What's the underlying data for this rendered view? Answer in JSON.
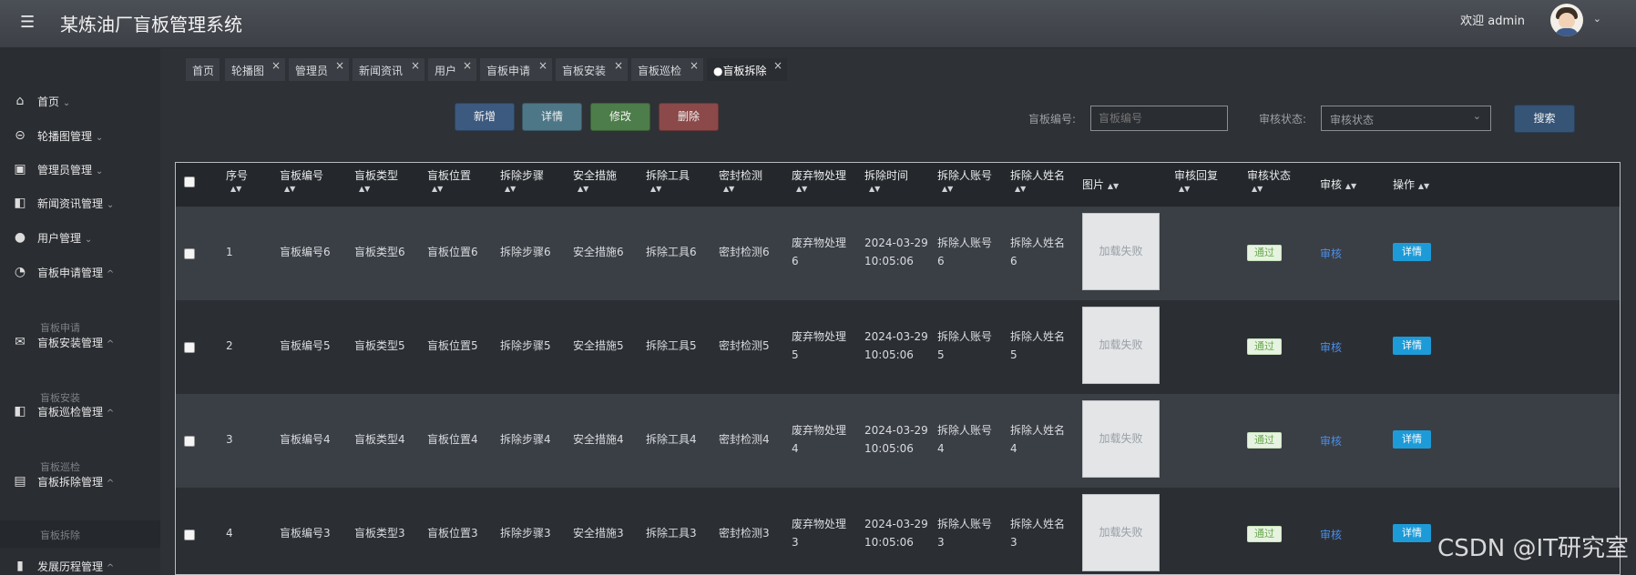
{
  "header": {
    "menu_icon": "hamburger-icon",
    "title": "某炼油厂盲板管理系统",
    "welcome": "欢迎 admin",
    "avatar_caret": "⌄"
  },
  "sidebar": {
    "items": [
      {
        "label": "首页",
        "icon": "home-icon",
        "caret": "⌄"
      },
      {
        "label": "轮播图管理",
        "icon": "dots-icon",
        "caret": "⌄"
      },
      {
        "label": "管理员管理",
        "icon": "user-square-icon",
        "caret": "⌄"
      },
      {
        "label": "新闻资讯管理",
        "icon": "book-icon",
        "caret": "⌄"
      },
      {
        "label": "用户管理",
        "icon": "person-icon",
        "caret": "⌄"
      },
      {
        "label": "盲板申请管理",
        "icon": "gauge-icon",
        "caret": "^"
      },
      {
        "label": "盲板安装管理",
        "icon": "envelope-icon",
        "caret": "^"
      },
      {
        "label": "盲板巡检管理",
        "icon": "book-icon",
        "caret": "^"
      },
      {
        "label": "盲板拆除管理",
        "icon": "briefcase-icon",
        "caret": "^"
      },
      {
        "label": "发展历程管理",
        "icon": "doc-icon",
        "caret": "^"
      }
    ],
    "subitems": [
      "盲板申请",
      "盲板安装",
      "盲板巡检",
      "盲板拆除"
    ]
  },
  "tabs": [
    {
      "label": "首页",
      "close": ""
    },
    {
      "label": "轮播图",
      "close": "×"
    },
    {
      "label": "管理员",
      "close": "×"
    },
    {
      "label": "新闻资讯",
      "close": "×"
    },
    {
      "label": "用户",
      "close": "×"
    },
    {
      "label": "盲板申请",
      "close": "×"
    },
    {
      "label": "盲板安装",
      "close": "×"
    },
    {
      "label": "盲板巡检",
      "close": "×"
    },
    {
      "label": "●盲板拆除",
      "close": "×"
    }
  ],
  "toolbar": {
    "add": "新增",
    "detail": "详情",
    "edit": "修改",
    "delete": "删除"
  },
  "filters": {
    "code_label": "盲板编号:",
    "code_placeholder": "盲板编号",
    "status_label": "审核状态:",
    "status_value": "审核状态",
    "status_caret": "⌄",
    "search": "搜索"
  },
  "table": {
    "headers": [
      "序号",
      "盲板编号",
      "盲板类型",
      "盲板位置",
      "拆除步骤",
      "安全措施",
      "拆除工具",
      "密封检测",
      "废弃物处理",
      "拆除时间",
      "拆除人账号",
      "拆除人姓名",
      "图片",
      "审核回复",
      "审核状态",
      "审核",
      "操作"
    ],
    "sort_glyph": "▲▼",
    "rows": [
      {
        "no": "1",
        "code": "盲板编号6",
        "type": "盲板类型6",
        "pos": "盲板位置6",
        "steps": "拆除步骤6",
        "safety": "安全措施6",
        "tool": "拆除工具6",
        "seal": "密封检测6",
        "waste1": "废弃物处理",
        "waste2": "6",
        "date": "2024-03-29",
        "time": "10:05:06",
        "acc1": "拆除人账号",
        "acc2": "6",
        "name1": "拆除人姓名",
        "name2": "6",
        "img": "加载失败",
        "status": "通过",
        "audit": "审核",
        "op": "详情"
      },
      {
        "no": "2",
        "code": "盲板编号5",
        "type": "盲板类型5",
        "pos": "盲板位置5",
        "steps": "拆除步骤5",
        "safety": "安全措施5",
        "tool": "拆除工具5",
        "seal": "密封检测5",
        "waste1": "废弃物处理",
        "waste2": "5",
        "date": "2024-03-29",
        "time": "10:05:06",
        "acc1": "拆除人账号",
        "acc2": "5",
        "name1": "拆除人姓名",
        "name2": "5",
        "img": "加载失败",
        "status": "通过",
        "audit": "审核",
        "op": "详情"
      },
      {
        "no": "3",
        "code": "盲板编号4",
        "type": "盲板类型4",
        "pos": "盲板位置4",
        "steps": "拆除步骤4",
        "safety": "安全措施4",
        "tool": "拆除工具4",
        "seal": "密封检测4",
        "waste1": "废弃物处理",
        "waste2": "4",
        "date": "2024-03-29",
        "time": "10:05:06",
        "acc1": "拆除人账号",
        "acc2": "4",
        "name1": "拆除人姓名",
        "name2": "4",
        "img": "加载失败",
        "status": "通过",
        "audit": "审核",
        "op": "详情"
      },
      {
        "no": "4",
        "code": "盲板编号3",
        "type": "盲板类型3",
        "pos": "盲板位置3",
        "steps": "拆除步骤3",
        "safety": "安全措施3",
        "tool": "拆除工具3",
        "seal": "密封检测3",
        "waste1": "废弃物处理",
        "waste2": "3",
        "date": "2024-03-29",
        "time": "10:05:06",
        "acc1": "拆除人账号",
        "acc2": "3",
        "name1": "拆除人姓名",
        "name2": "3",
        "img": "加载失败",
        "status": "通过",
        "audit": "审核",
        "op": "详情"
      }
    ]
  },
  "watermark": "CSDN @IT研究室",
  "colors": {
    "add": "#3c5a80",
    "detail": "#4d7686",
    "edit": "#4d7d4a",
    "delete": "#8c4949",
    "search": "#365476",
    "link": "#4a8ee8",
    "detail_btn": "#1d9bd8"
  }
}
